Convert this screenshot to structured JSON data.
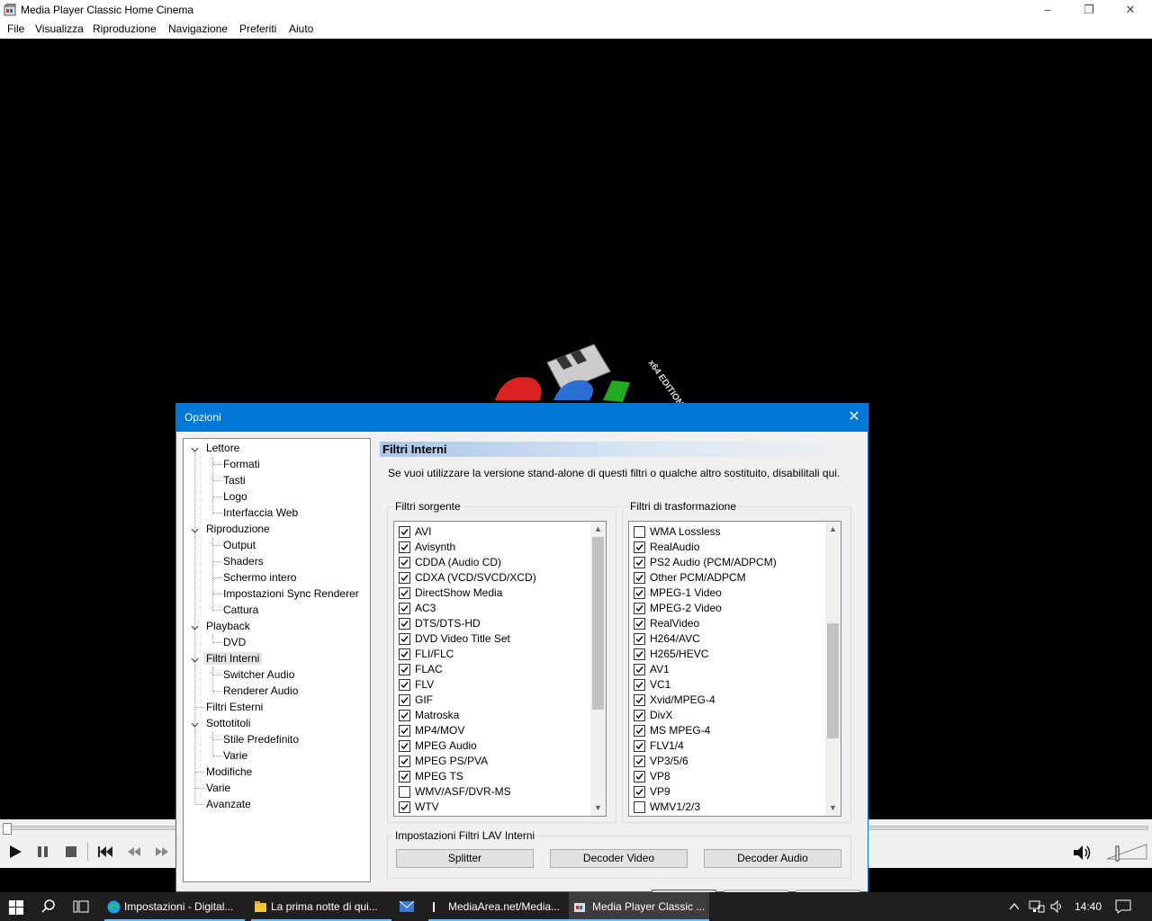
{
  "window": {
    "title": "Media Player Classic Home Cinema",
    "menu": [
      "File",
      "Visualizza",
      "Riproduzione",
      "Navigazione",
      "Preferiti",
      "Aiuto"
    ]
  },
  "logo": {
    "edition": "x64 EDITION"
  },
  "dialog": {
    "title": "Opzioni",
    "tree": [
      {
        "label": "Lettore",
        "children": [
          "Formati",
          "Tasti",
          "Logo",
          "Interfaccia Web"
        ]
      },
      {
        "label": "Riproduzione",
        "children": [
          "Output",
          "Shaders",
          "Schermo intero",
          "Impostazioni Sync Renderer",
          "Cattura"
        ]
      },
      {
        "label": "Playback",
        "children": [
          "DVD"
        ]
      },
      {
        "label": "Filtri Interni",
        "children": [
          "Switcher Audio",
          "Renderer Audio"
        ],
        "selected": true
      },
      {
        "label": "Filtri Esterni",
        "children": []
      },
      {
        "label": "Sottotitoli",
        "children": [
          "Stile Predefinito",
          "Varie"
        ]
      },
      {
        "label": "Modifiche",
        "children": []
      },
      {
        "label": "Varie",
        "children": []
      },
      {
        "label": "Avanzate",
        "children": []
      }
    ],
    "panel": {
      "title": "Filtri Interni",
      "description": "Se vuoi utilizzare la versione stand-alone di questi filtri o qualche altro sostituito, disabilitali qui.",
      "source_group": "Filtri sorgente",
      "transform_group": "Filtri di trasformazione",
      "lav_group": "Impostazioni Filtri LAV Interni",
      "source_filters": [
        {
          "label": "AVI",
          "checked": true
        },
        {
          "label": "Avisynth",
          "checked": true
        },
        {
          "label": "CDDA (Audio CD)",
          "checked": true
        },
        {
          "label": "CDXA (VCD/SVCD/XCD)",
          "checked": true
        },
        {
          "label": "DirectShow Media",
          "checked": true
        },
        {
          "label": "AC3",
          "checked": true
        },
        {
          "label": "DTS/DTS-HD",
          "checked": true
        },
        {
          "label": "DVD Video Title Set",
          "checked": true
        },
        {
          "label": "FLI/FLC",
          "checked": true
        },
        {
          "label": "FLAC",
          "checked": true
        },
        {
          "label": "FLV",
          "checked": true
        },
        {
          "label": "GIF",
          "checked": true
        },
        {
          "label": "Matroska",
          "checked": true
        },
        {
          "label": "MP4/MOV",
          "checked": true
        },
        {
          "label": "MPEG Audio",
          "checked": true
        },
        {
          "label": "MPEG PS/PVA",
          "checked": true
        },
        {
          "label": "MPEG TS",
          "checked": true
        },
        {
          "label": "WMV/ASF/DVR-MS",
          "checked": false
        },
        {
          "label": "WTV",
          "checked": true
        }
      ],
      "transform_filters": [
        {
          "label": "WMA Lossless",
          "checked": false
        },
        {
          "label": "RealAudio",
          "checked": true
        },
        {
          "label": "PS2 Audio (PCM/ADPCM)",
          "checked": true
        },
        {
          "label": "Other PCM/ADPCM",
          "checked": true
        },
        {
          "label": "MPEG-1 Video",
          "checked": true
        },
        {
          "label": "MPEG-2 Video",
          "checked": true
        },
        {
          "label": "RealVideo",
          "checked": true
        },
        {
          "label": "H264/AVC",
          "checked": true
        },
        {
          "label": "H265/HEVC",
          "checked": true
        },
        {
          "label": "AV1",
          "checked": true
        },
        {
          "label": "VC1",
          "checked": true
        },
        {
          "label": "Xvid/MPEG-4",
          "checked": true
        },
        {
          "label": "DivX",
          "checked": true
        },
        {
          "label": "MS MPEG-4",
          "checked": true
        },
        {
          "label": "FLV1/4",
          "checked": true
        },
        {
          "label": "VP3/5/6",
          "checked": true
        },
        {
          "label": "VP8",
          "checked": true
        },
        {
          "label": "VP9",
          "checked": true
        },
        {
          "label": "WMV1/2/3",
          "checked": false
        }
      ],
      "buttons": {
        "splitter": "Splitter",
        "video": "Decoder Video",
        "audio": "Decoder Audio"
      }
    }
  },
  "taskbar": {
    "apps": [
      "Impostazioni - Digital...",
      "La prima notte di qui...",
      "",
      "MediaArea.net/Media...",
      "Media Player Classic ..."
    ],
    "clock": "14:40"
  }
}
